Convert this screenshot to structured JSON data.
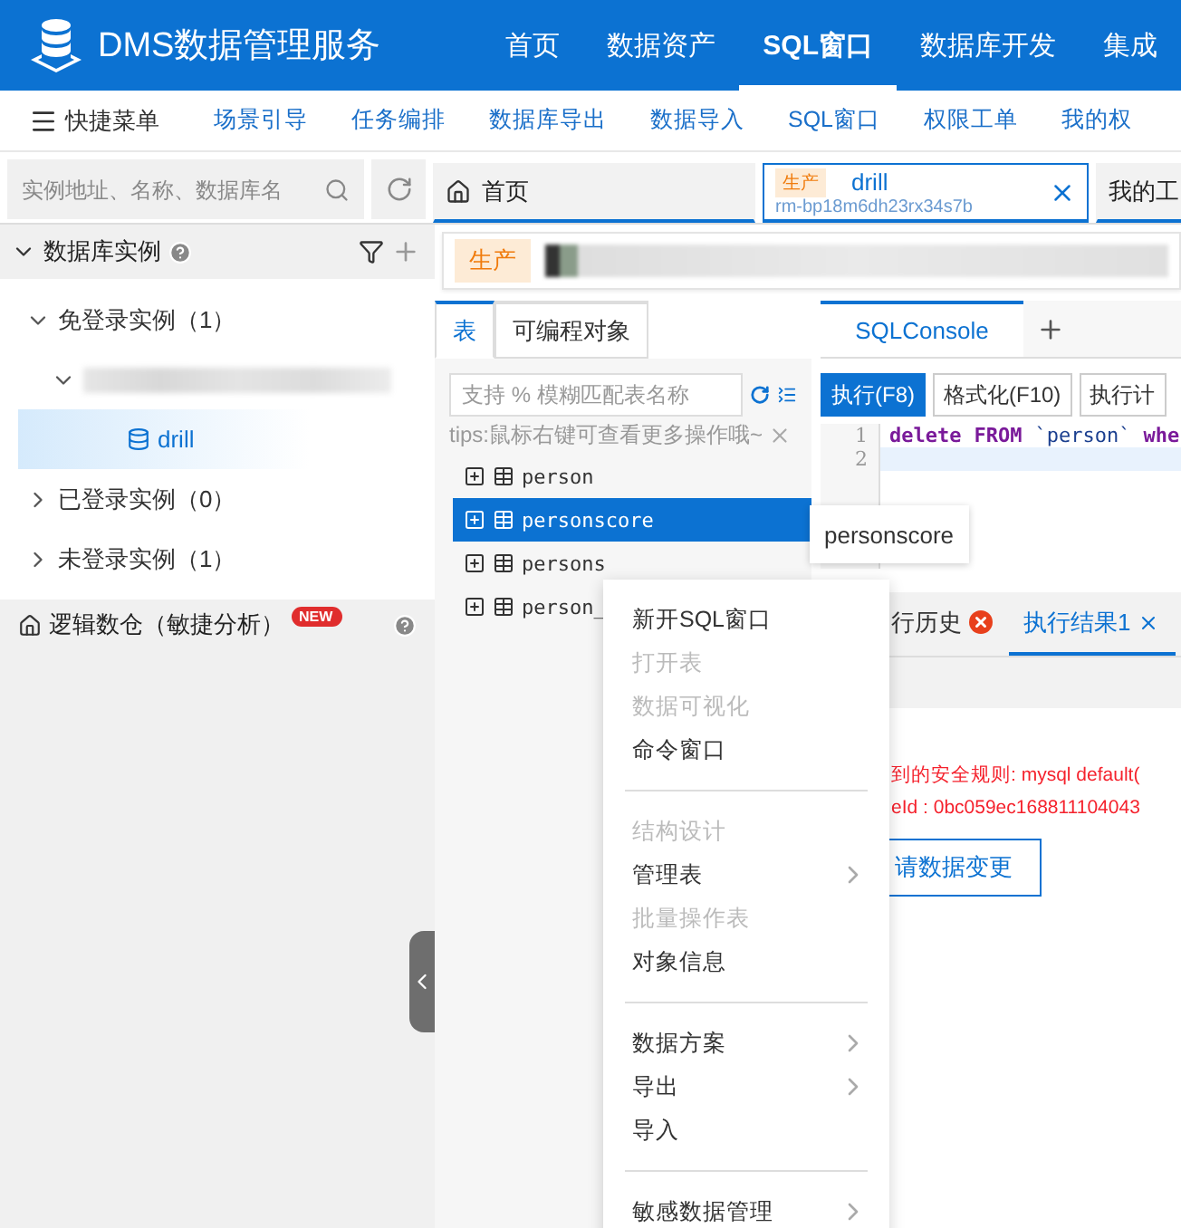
{
  "header": {
    "title": "DMS数据管理服务",
    "nav": [
      {
        "label": "首页",
        "selected": false
      },
      {
        "label": "数据资产",
        "selected": false
      },
      {
        "label": "SQL窗口",
        "selected": true
      },
      {
        "label": "数据库开发",
        "selected": false
      },
      {
        "label": "集成",
        "selected": false
      }
    ]
  },
  "quick_menu": {
    "label": "快捷菜单",
    "links": [
      "场景引导",
      "任务编排",
      "数据库导出",
      "数据导入",
      "SQL窗口",
      "权限工单",
      "我的权"
    ]
  },
  "instance_search": {
    "placeholder": "实例地址、名称、数据库名"
  },
  "doc_tabs": [
    {
      "title": "首页",
      "kind": "home",
      "selected": false
    },
    {
      "title": "drill",
      "kind": "database",
      "env": "生产",
      "subtitle": "rm-bp18m6dh23rx34s7b",
      "selected": true
    },
    {
      "title": "我的工",
      "kind": "plain",
      "selected": false
    }
  ],
  "sidebar": {
    "title": "数据库实例",
    "tree": [
      {
        "label": "免登录实例（1）",
        "kind": "group",
        "expanded": true,
        "children": [
          {
            "kind": "redacted",
            "expanded": true,
            "children": [
              {
                "label": "drill",
                "kind": "database",
                "selected": true
              }
            ]
          }
        ]
      },
      {
        "label": "已登录实例（0）",
        "kind": "group",
        "expanded": false
      },
      {
        "label": "未登录实例（1）",
        "kind": "group",
        "expanded": false
      }
    ],
    "footer": {
      "label": "逻辑数仓（敏捷分析）",
      "badge": "NEW"
    }
  },
  "env_bar": {
    "env": "生产"
  },
  "object_panel": {
    "tabs": [
      {
        "label": "表",
        "selected": true
      },
      {
        "label": "可编程对象",
        "selected": false
      }
    ],
    "search": {
      "placeholder": "支持 % 模糊匹配表名称"
    },
    "tip": "tips:鼠标右键可查看更多操作哦~",
    "tables": [
      {
        "name": "person",
        "selected": false
      },
      {
        "name": "personscore",
        "selected": true
      },
      {
        "name": "persons",
        "selected": false
      },
      {
        "name": "person_",
        "selected": false
      }
    ]
  },
  "tooltip": "personscore",
  "console": {
    "tabs": [
      {
        "label": "SQLConsole",
        "selected": true
      }
    ],
    "toolbar": [
      {
        "label": "执行(F8)",
        "primary": true
      },
      {
        "label": "格式化(F10)",
        "primary": false
      },
      {
        "label": "执行计",
        "primary": false
      }
    ],
    "lines": [
      {
        "number": "1",
        "current": false,
        "code": [
          {
            "kind": "keyword",
            "text": "delete"
          },
          {
            "kind": "keyword",
            "text": "FROM"
          },
          {
            "kind": "identifier",
            "text": "`person`"
          },
          {
            "kind": "keyword",
            "text": "whe"
          }
        ]
      },
      {
        "number": "2",
        "current": true
      }
    ]
  },
  "results": {
    "tabs": [
      {
        "label": "行历史",
        "selected": false,
        "error": true
      },
      {
        "label": "执行结果1",
        "selected": true,
        "error": false
      }
    ],
    "messages": [
      "到的安全规则: mysql default(",
      "eId : 0bc059ec168811104043"
    ],
    "action": "请数据变更"
  },
  "context_menu": {
    "groups": [
      {
        "items": [
          {
            "label": "新开SQL窗口",
            "disabled": false,
            "submenu": false
          },
          {
            "label": "打开表",
            "disabled": true,
            "submenu": false
          },
          {
            "label": "数据可视化",
            "disabled": true,
            "submenu": false
          },
          {
            "label": "命令窗口",
            "disabled": false,
            "submenu": false
          }
        ]
      },
      {
        "items": [
          {
            "label": "结构设计",
            "disabled": true,
            "submenu": false
          },
          {
            "label": "管理表",
            "disabled": false,
            "submenu": true
          },
          {
            "label": "批量操作表",
            "disabled": true,
            "submenu": false
          },
          {
            "label": "对象信息",
            "disabled": false,
            "submenu": false
          }
        ]
      },
      {
        "items": [
          {
            "label": "数据方案",
            "disabled": false,
            "submenu": true
          },
          {
            "label": "导出",
            "disabled": false,
            "submenu": true
          },
          {
            "label": "导入",
            "disabled": false,
            "submenu": false
          }
        ]
      },
      {
        "items": [
          {
            "label": "敏感数据管理",
            "disabled": false,
            "submenu": true
          }
        ]
      }
    ]
  }
}
